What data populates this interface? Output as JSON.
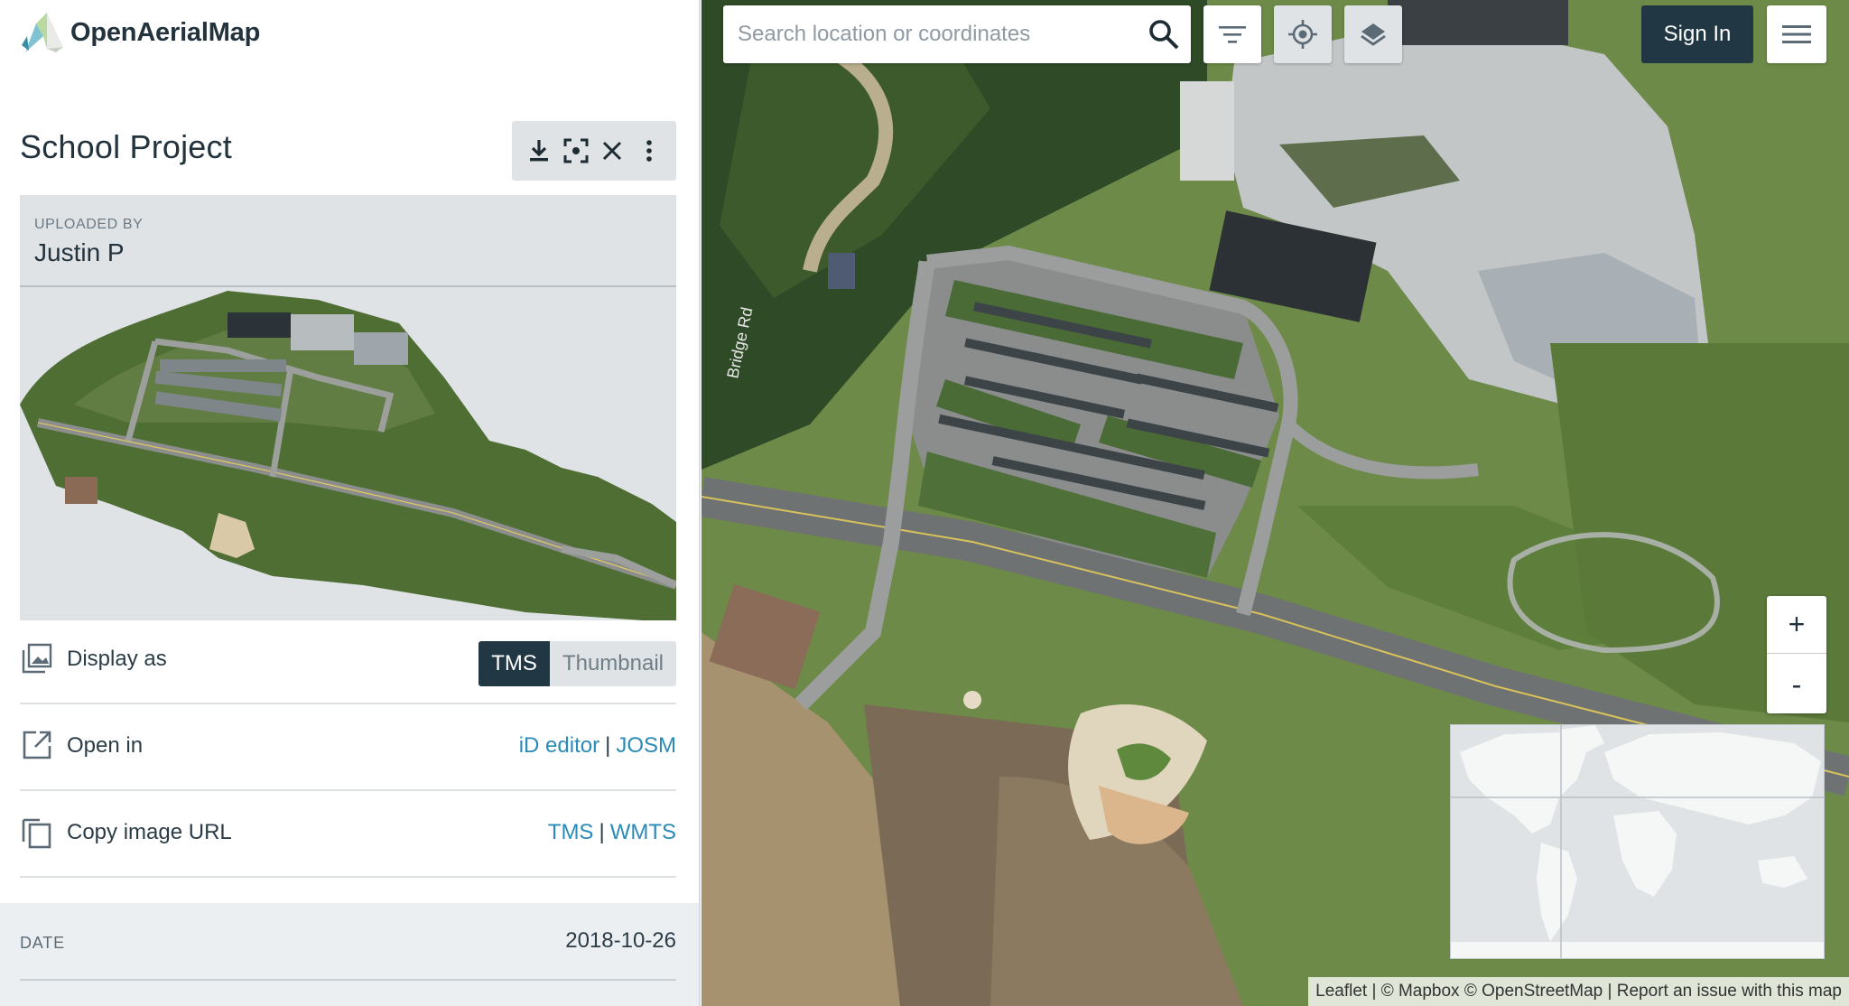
{
  "app": {
    "brand": "OpenAerialMap"
  },
  "scene": {
    "title": "School Project",
    "uploaded_by_label": "UPLOADED BY",
    "uploaded_by": "Justin P",
    "toolbar": [
      "download-icon",
      "focus-icon",
      "close-icon",
      "more-vertical-icon"
    ]
  },
  "display_as": {
    "label": "Display as",
    "options": [
      "TMS",
      "Thumbnail"
    ],
    "selected": "TMS"
  },
  "open_in": {
    "label": "Open in",
    "links": [
      "iD editor",
      "JOSM"
    ],
    "separator": "|"
  },
  "copy_url": {
    "label": "Copy image URL",
    "links": [
      "TMS",
      "WMTS"
    ],
    "separator": "|"
  },
  "meta": {
    "date_label": "DATE",
    "date_value": "2018-10-26"
  },
  "map": {
    "search_placeholder": "Search location or coordinates",
    "sign_in": "Sign In",
    "zoom_in": "+",
    "zoom_out": "-",
    "street_label": "Bridge Rd",
    "attribution": {
      "leaflet": "Leaflet",
      "mapbox": "© Mapbox",
      "osm": "© OpenStreetMap",
      "report": "Report an issue with this map",
      "sep": "|"
    },
    "icons": {
      "search": "search-icon",
      "filter": "filter-icon",
      "locate": "crosshair-icon",
      "layers": "layers-icon",
      "menu": "hamburger-icon"
    },
    "colors": {
      "accent_dark": "#213744",
      "link": "#2a8bb8",
      "panel_grey": "#dfe3e6"
    }
  }
}
